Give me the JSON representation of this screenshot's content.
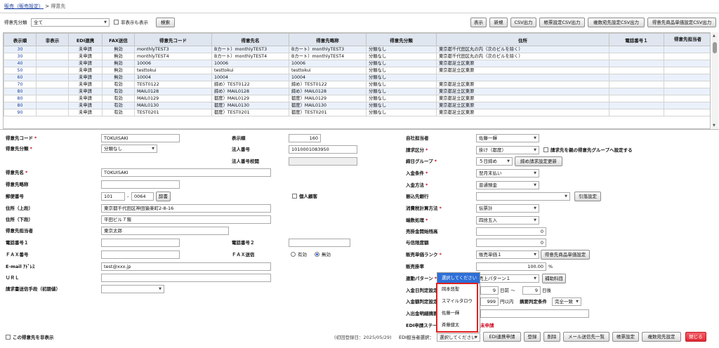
{
  "breadcrumb": {
    "parent": "販売（販売設定）",
    "sep": ">",
    "current": "得意先"
  },
  "filter": {
    "category_label": "得意先分類",
    "category_value": "全て",
    "show_hidden_label": "非表示も表示",
    "search_button": "検索"
  },
  "toolbar": [
    "表示",
    "新規",
    "CSV出力",
    "帳票設定CSV出力",
    "複数宛先設定CSV出力",
    "得意先商品単価設定CSV出力"
  ],
  "table": {
    "headers": [
      "表示順",
      "非表示",
      "EDI連携",
      "FAX送信",
      "得意先コード",
      "得意先名",
      "得意先略称",
      "得意先分類",
      "住所",
      "電話番号１",
      "得意先担当者"
    ],
    "rows": [
      [
        "30",
        "",
        "未申請",
        "無効",
        "monthlyTEST3",
        "Bカート）monthlyTEST3",
        "Bカート）monthlyTEST3",
        "分類なし",
        "東京都千代田区丸の内（次のビルを除く）",
        "",
        ""
      ],
      [
        "30",
        "",
        "未申請",
        "無効",
        "monthlyTEST4",
        "Bカート）monthlyTEST4",
        "Bカート）monthlyTEST4",
        "分類なし",
        "東京都千代田区丸の内（次のビルを除く）",
        "",
        ""
      ],
      [
        "40",
        "",
        "未申請",
        "無効",
        "10006",
        "10006",
        "10006",
        "分類なし",
        "東京都足立区東原",
        "",
        ""
      ],
      [
        "50",
        "",
        "未申請",
        "無効",
        "testtokui",
        "testtokui",
        "testtokui",
        "分類なし",
        "東京都足立区東原",
        "",
        ""
      ],
      [
        "60",
        "",
        "未申請",
        "無効",
        "10004",
        "10004",
        "10004",
        "分類なし",
        "",
        "",
        ""
      ],
      [
        "70",
        "",
        "未申請",
        "有効",
        "TEST0122",
        "締め）TEST0122",
        "締め）TEST0122",
        "分類なし",
        "東京都足立区東原",
        "",
        ""
      ],
      [
        "80",
        "",
        "未申請",
        "有効",
        "MAIL0128",
        "締め）MAIL0128",
        "締め）MAIL0128",
        "分類なし",
        "東京都足立区東原",
        "",
        ""
      ],
      [
        "80",
        "",
        "未申請",
        "有効",
        "MAIL0129",
        "都度）MAIL0129",
        "都度）MAIL0129",
        "分類なし",
        "東京都足立区東原",
        "",
        ""
      ],
      [
        "80",
        "",
        "未申請",
        "有効",
        "MAIL0130",
        "都度）MAIL0130",
        "都度）MAIL0130",
        "分類なし",
        "東京都足立区東原",
        "",
        ""
      ],
      [
        "90",
        "",
        "未申請",
        "有効",
        "TEST0201",
        "都度）TEST0201",
        "都度）TEST0201",
        "分類なし",
        "東京都足立区東原",
        "",
        ""
      ]
    ]
  },
  "form": {
    "code_label": "得意先コード",
    "code_value": "TOKUISAKI",
    "bunrui_label": "得意先分類",
    "bunrui_value": "分類なし",
    "hyojijun_label": "表示順",
    "hyojijun_value": "160",
    "houjin_label": "法人番号",
    "houjin_value": "1010001083950",
    "houjin_check_label": "法人番号校閲",
    "name_label": "得意先名",
    "name_value": "TOKUISAKI",
    "ryaku_label": "得意先略称",
    "kojin_label": "個人顧客",
    "zip_label": "郵便番号",
    "zip1": "101",
    "zip_dash": "-",
    "zip2": "0064",
    "dict_button": "辞書",
    "addr1_label": "住所（上段）",
    "addr1_value": "東京都千代田区神田猿楽町2-8-16",
    "addr2_label": "住所（下段）",
    "addr2_value": "平田ビル７階",
    "tanto_label": "得意先担当者",
    "tanto_value": "東京太郎",
    "tel1_label": "電話番号１",
    "tel2_label": "電話番号２",
    "fax_label": "ＦＡＸ番号",
    "faxsend_label": "ＦＡＸ送信",
    "fax_on": "有効",
    "fax_off": "無効",
    "email_label": "E-mail ｱﾄﾞﾚｽ",
    "email_value": "test@xxx.jp",
    "url_label": "ＵＲＬ",
    "seikyu_label": "請求書送信手段（初期値）",
    "jisha_label": "自社担当者",
    "jisha_value": "佐藤一輝",
    "seikyukubun_label": "請求区分",
    "seikyukubun_value": "掛け（都度）",
    "oya_label": "請求先を親の得意先グループへ設定する",
    "shime_label": "締日グループ",
    "shime_value": "５日締め",
    "shime_button": "締め請求設定更新",
    "nyukin_label": "入金条件",
    "nyukin_value": "翌月末払い",
    "nyukinhoho_label": "入金方法",
    "nyukinhoho_value": "普通預金",
    "furikomi_label": "振込先銀行",
    "hikiate_button": "引落設定",
    "shohizei_label": "消費税計算方法",
    "shohizei_value": "伝票計",
    "hasu_label": "端数処理",
    "hasu_value": "四捨五入",
    "urikake_label": "売掛金開始残高",
    "urikake_value": "0",
    "yoshin_label": "与信限度額",
    "yoshin_value": "0",
    "rank_label": "販売単価ランク",
    "rank_value": "販売単価１",
    "rank_button": "得意先商品単価設定",
    "kakeritsu_label": "販売掛率",
    "kakeritsu_value": "100.00",
    "percent": "%",
    "renkei_label": "連動パターン",
    "renkei_value": "売上パターン１",
    "hojo_button": "補助科目",
    "nyukinbi_label": "入金日判定設定",
    "day_from": "9",
    "day_from_unit": "日前 〜",
    "day_to": "9",
    "day_to_unit": "日後",
    "kingaku_label": "入金額判定設定",
    "kingaku_value": "999",
    "kingaku_unit": "円以内",
    "tekiyo_label": "摘要判定条件",
    "tekiyo_value": "完全一致",
    "meisai_label": "入出金明細摘要",
    "edi_status_label": "EDI申請ステータス",
    "edi_status_value": "未申請"
  },
  "popup": {
    "header": "選択してください",
    "items": [
      "岡本悠聖",
      "スマイルタロウ",
      "佐藤一輝",
      "斉藤健太"
    ]
  },
  "footer": {
    "hide_label": "この得意先を非表示",
    "registered": "(初回登録日：2025/05/29)",
    "edi_tanto_label": "EDI担当者選択：",
    "edi_tanto_value": "選択してください",
    "buttons": [
      "EDI連携申請",
      "登録",
      "削除",
      "メール送信先一覧",
      "帳票設定",
      "複数宛先設定",
      "閉じる"
    ]
  }
}
